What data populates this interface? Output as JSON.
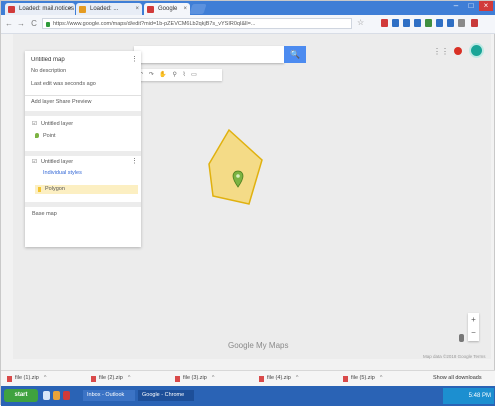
{
  "browser": {
    "tabs": [
      {
        "label": "Loaded: mail.notices",
        "fav_color": "#d13a3a"
      },
      {
        "label": "Loaded: ...",
        "fav_color": "#e59b21"
      },
      {
        "label": "Google",
        "fav_color": "#d13a3a"
      }
    ],
    "nav": {
      "back": "←",
      "forward": "→",
      "reload": "C"
    },
    "address": "https://www.google.com/maps/d/edit?mid=1b-pZEVCM6Lb2qkjB7s_vYSIR0qI&ll=...",
    "window": {
      "minimize": "–",
      "maximize": "□",
      "close": "×"
    }
  },
  "map": {
    "search_placeholder": "",
    "search_button": "🔍",
    "tools": "↶ ↷ ✋ ⚲ ⌇ ▭",
    "apps_icon": "⋮⋮",
    "google_logo": "Google My Maps",
    "map_data": "Map data ©2018 Google  Terms",
    "zoom_in": "+",
    "zoom_out": "−",
    "panel": {
      "title": "Untitled map",
      "subtitle": "No description",
      "views": "Last edit was seconds ago",
      "actions": "Add layer   Share   Preview",
      "layer1_title": "Untitled layer",
      "layer1_item": "Point",
      "layer2_title": "Untitled layer",
      "layer2_style": "Individual styles",
      "layer2_item": "Polygon",
      "base_map": "Base map"
    },
    "polygon_color": "#f4c430",
    "marker_color": "#7cb342"
  },
  "downloads": {
    "items": [
      {
        "label": "file (1).zip"
      },
      {
        "label": "file (2).zip"
      },
      {
        "label": "file (3).zip"
      },
      {
        "label": "file (4).zip"
      },
      {
        "label": "file (5).zip"
      }
    ],
    "show_all": "Show all downloads"
  },
  "taskbar": {
    "start": "start",
    "items": [
      {
        "label": "Inbox - Outlook"
      },
      {
        "label": "Google - Chrome"
      }
    ],
    "clock": "5:48 PM"
  }
}
